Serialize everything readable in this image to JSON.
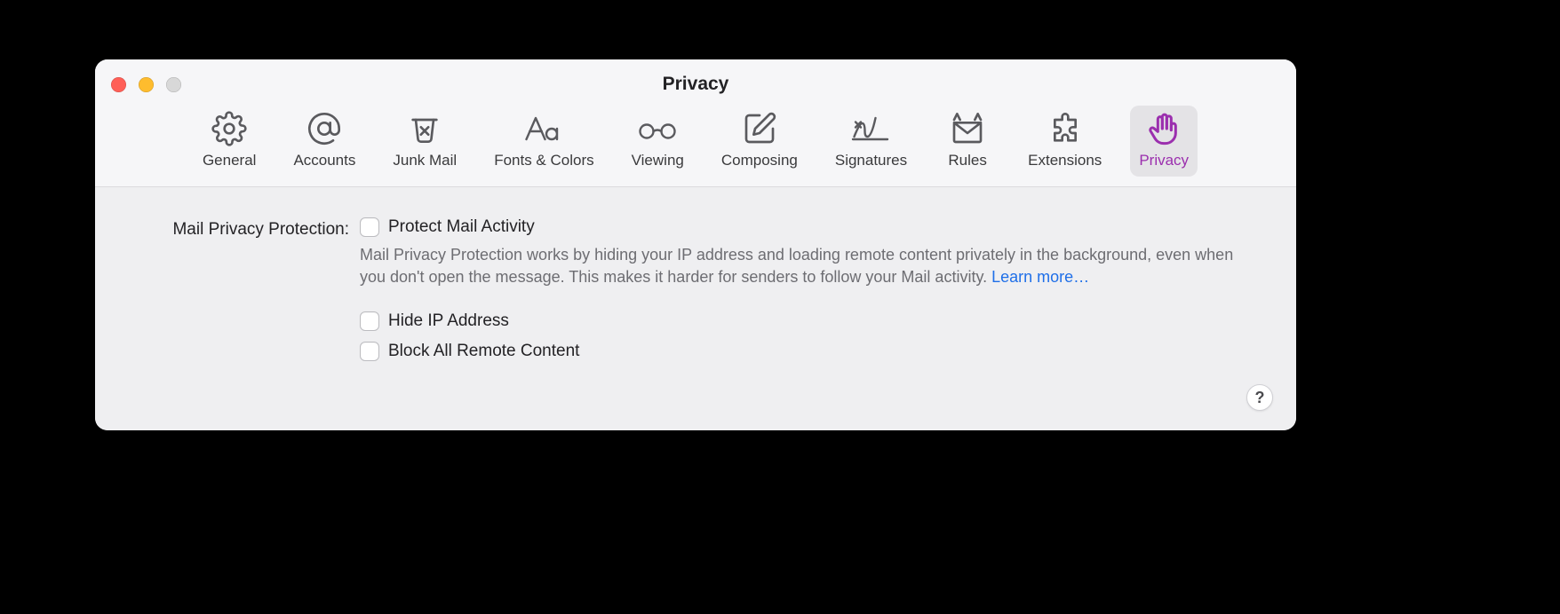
{
  "window": {
    "title": "Privacy"
  },
  "toolbar": {
    "items": [
      {
        "id": "general",
        "label": "General"
      },
      {
        "id": "accounts",
        "label": "Accounts"
      },
      {
        "id": "junk",
        "label": "Junk Mail"
      },
      {
        "id": "fonts",
        "label": "Fonts & Colors"
      },
      {
        "id": "viewing",
        "label": "Viewing"
      },
      {
        "id": "composing",
        "label": "Composing"
      },
      {
        "id": "signatures",
        "label": "Signatures"
      },
      {
        "id": "rules",
        "label": "Rules"
      },
      {
        "id": "extensions",
        "label": "Extensions"
      },
      {
        "id": "privacy",
        "label": "Privacy"
      }
    ],
    "selected": "privacy"
  },
  "section": {
    "heading": "Mail Privacy Protection:",
    "protect": {
      "label": "Protect Mail Activity",
      "checked": false
    },
    "description": "Mail Privacy Protection works by hiding your IP address and loading remote content privately in the background, even when you don't open the message. This makes it harder for senders to follow your Mail activity.",
    "learn_more": "Learn more…",
    "hide_ip": {
      "label": "Hide IP Address",
      "checked": false
    },
    "block_remote": {
      "label": "Block All Remote Content",
      "checked": false
    }
  },
  "help": "?"
}
